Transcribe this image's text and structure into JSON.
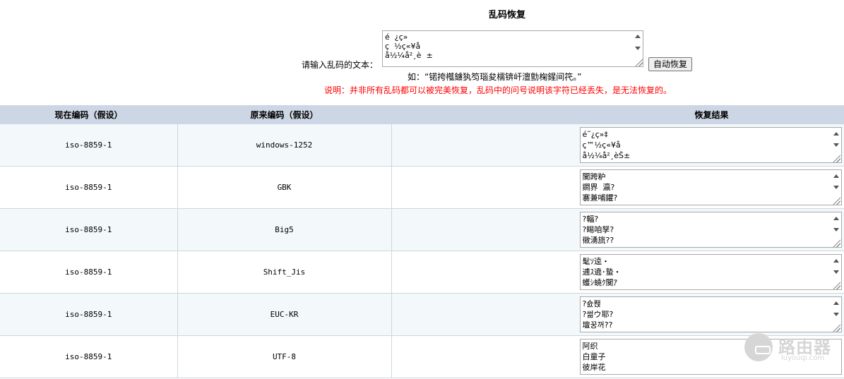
{
  "page": {
    "title": "乱码恢复",
    "input_label": "请输入乱码的文本：",
    "input_value": "é  ¿ç»\nç  ½ç«¥å\nå½¼å²¸è  ±",
    "recover_button": "自动恢复",
    "example": "如：“锘挎槬鐪犱笉瑙夋檽锛屽澶勯椈鍟间笩。”",
    "note": "说明：并非所有乱码都可以被完美恢复，乱码中的问号说明该字符已经丢失，是无法恢复的。"
  },
  "table": {
    "headers": [
      "现在编码（假设）",
      "原来编码（假设）",
      "",
      "恢复结果"
    ],
    "rows": [
      {
        "current": "iso-8859-1",
        "original": "windows-1252",
        "result": "é˜¿ç»‡\nç™½ç«¥å\nå½¼å²¸èŠ±"
      },
      {
        "current": "iso-8859-1",
        "original": "GBK",
        "result": "闃跨粐\n鐧界  瀛?\n褰兼哺鑺?"
      },
      {
        "current": "iso-8859-1",
        "original": "Big5",
        "result": "?輻?\n?睗咱孥?\n幑湧旒??"
      },
      {
        "current": "iso-8859-1",
        "original": "Shift_Jis",
        "result": "髦ｿ逵・\n逋ｽ遶･蟄・\n蠖ｼ蟯ｸ闃ｱ"
      },
      {
        "current": "iso-8859-1",
        "original": "EUC-KR",
        "result": "?숈퐩\n?썲ウ耶?\n壇꿍꺼??"
      },
      {
        "current": "iso-8859-1",
        "original": "UTF-8",
        "result": "阿织\n白童子\n彼岸花"
      }
    ]
  },
  "watermark": {
    "title": "路由器",
    "url": "luyouqi.com"
  }
}
